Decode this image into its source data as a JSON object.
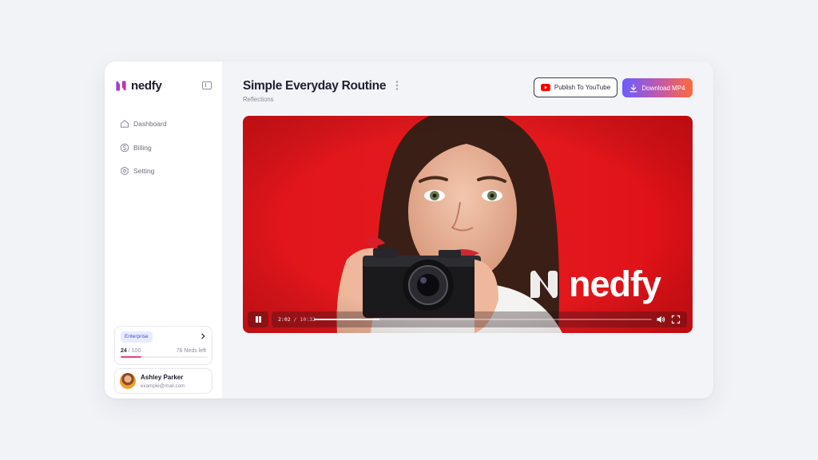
{
  "brand": {
    "name": "nedfy"
  },
  "sidebar": {
    "items": [
      {
        "label": "Dashboard",
        "icon": "home-icon"
      },
      {
        "label": "Billing",
        "icon": "dollar-icon"
      },
      {
        "label": "Setting",
        "icon": "gear-icon"
      }
    ]
  },
  "plan": {
    "badge": "Enterprise",
    "used": "24",
    "separator": "/",
    "total": "100",
    "left": "76 Neds left",
    "progress_fraction": 0.24
  },
  "user": {
    "name": "Ashley Parker",
    "email": "example@mail.com"
  },
  "header": {
    "title": "Simple Everyday Routine",
    "subtitle": "Reflections"
  },
  "actions": {
    "publish_label": "Publish To YouTube",
    "download_label": "Download MP4"
  },
  "video": {
    "watermark": "nedfy",
    "current_time": "2:02",
    "time_separator": " / ",
    "duration": "10:32",
    "progress_fraction": 0.193
  },
  "colors": {
    "accent": "#3d4fd8",
    "progress_pink": "#ec3f8a",
    "video_bg": "#e3161c",
    "youtube_red": "#ff0000"
  }
}
